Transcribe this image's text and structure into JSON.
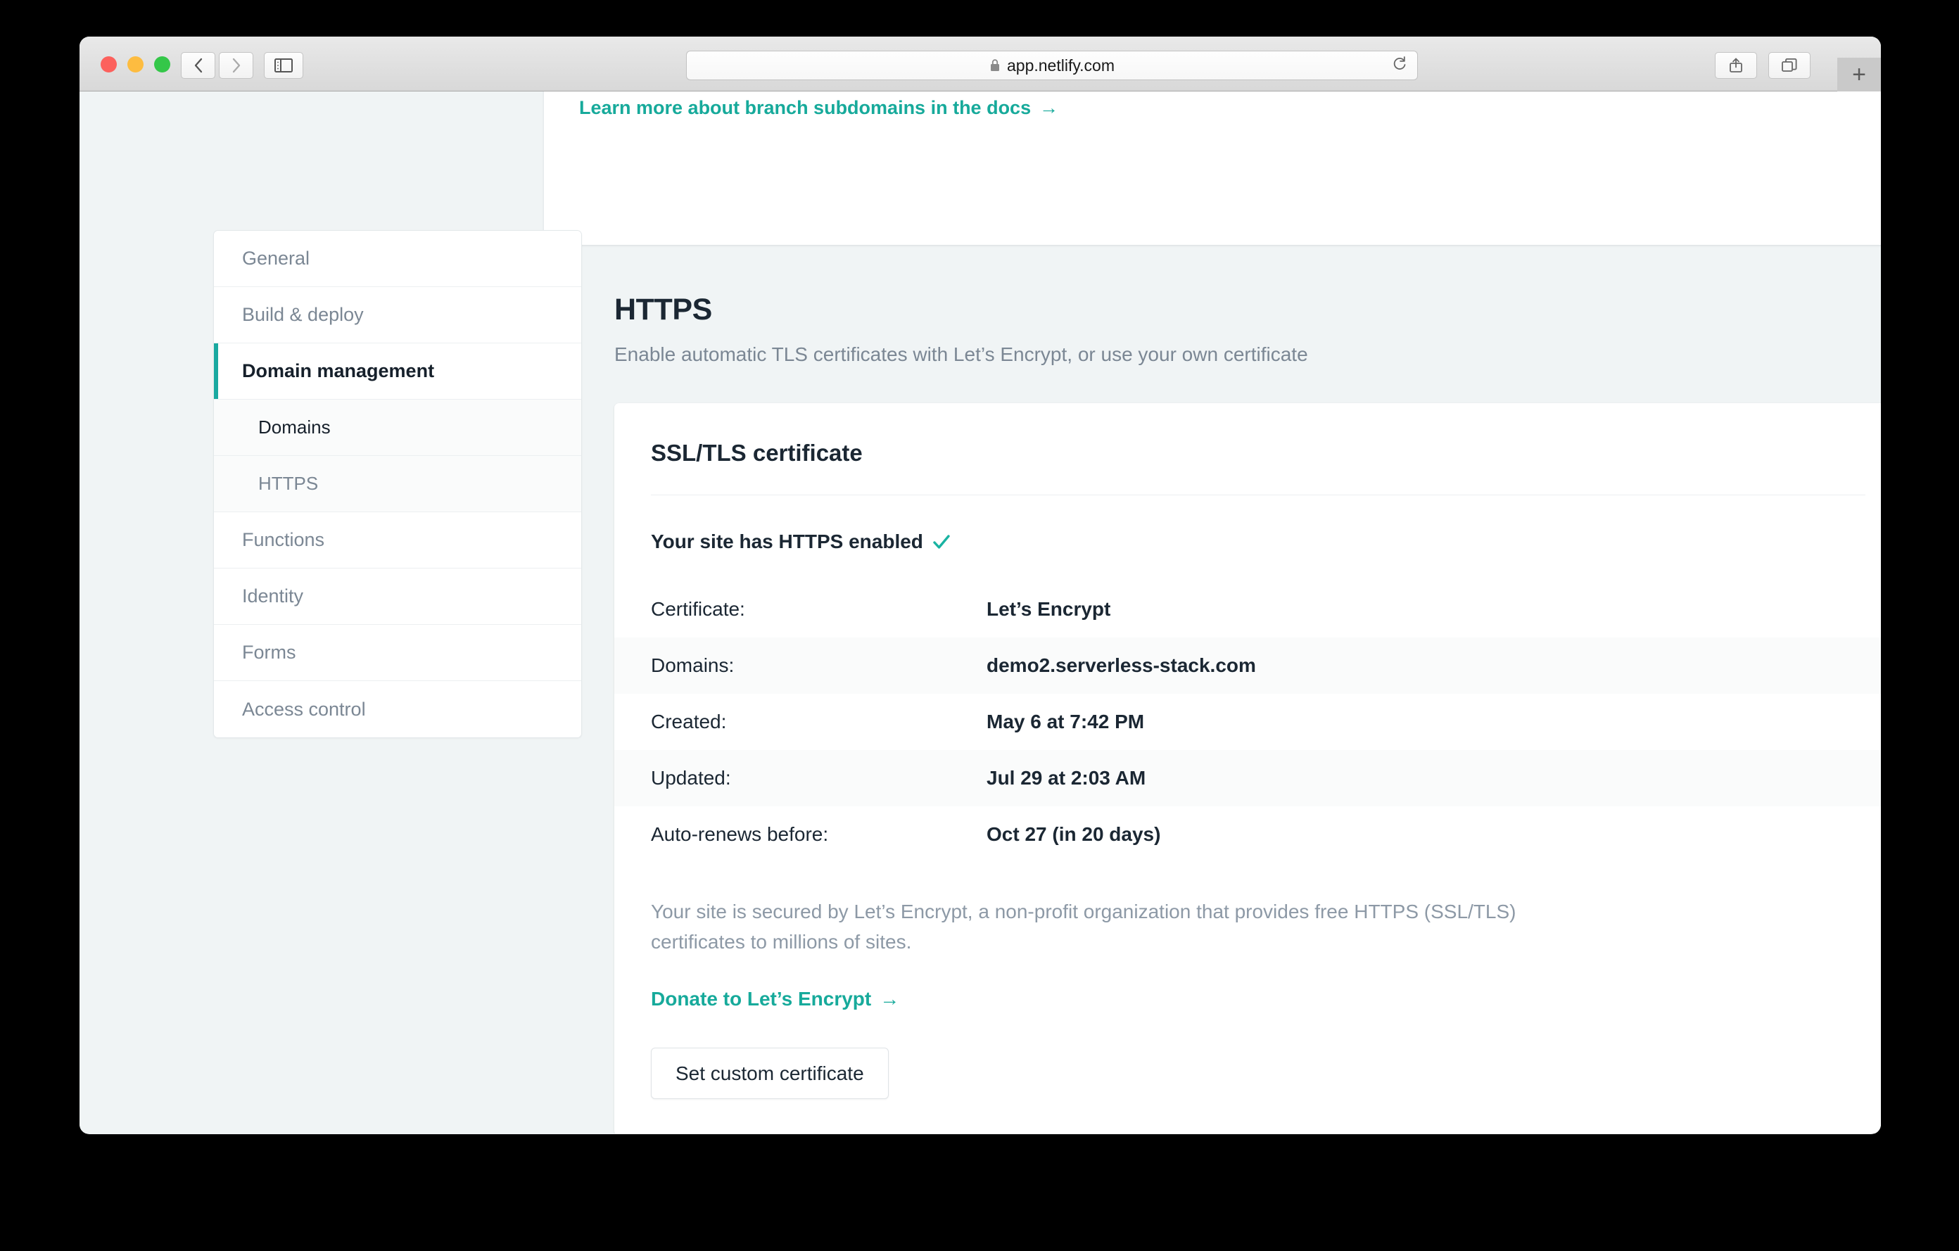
{
  "browser": {
    "url": "app.netlify.com",
    "lock_icon": "lock-icon",
    "back_icon": "chevron-left-icon",
    "forward_icon": "chevron-right-icon",
    "sidebar_icon": "sidebar-toggle-icon",
    "reload_icon": "reload-icon",
    "share_icon": "share-icon",
    "tabs_icon": "tab-overview-icon",
    "new_tab_label": "+"
  },
  "top_card": {
    "docs_link": "Learn more about branch subdomains in the docs",
    "arrow": "→"
  },
  "sidebar": {
    "items": [
      {
        "label": "General",
        "state": "default",
        "level": "top"
      },
      {
        "label": "Build & deploy",
        "state": "default",
        "level": "top"
      },
      {
        "label": "Domain management",
        "state": "active",
        "level": "top"
      },
      {
        "label": "Domains",
        "state": "current",
        "level": "sub"
      },
      {
        "label": "HTTPS",
        "state": "default",
        "level": "sub"
      },
      {
        "label": "Functions",
        "state": "default",
        "level": "top"
      },
      {
        "label": "Identity",
        "state": "default",
        "level": "top"
      },
      {
        "label": "Forms",
        "state": "default",
        "level": "top"
      },
      {
        "label": "Access control",
        "state": "default",
        "level": "top"
      }
    ]
  },
  "main": {
    "title": "HTTPS",
    "subtitle": "Enable automatic TLS certificates with Let’s Encrypt, or use your own certificate"
  },
  "certificate_card": {
    "title": "SSL/TLS certificate",
    "status_text": "Your site has HTTPS enabled",
    "status_check": "✓",
    "rows": [
      {
        "label": "Certificate:",
        "value": "Let’s Encrypt"
      },
      {
        "label": "Domains:",
        "value": "demo2.serverless-stack.com"
      },
      {
        "label": "Created:",
        "value": "May 6 at 7:42 PM"
      },
      {
        "label": "Updated:",
        "value": "Jul 29 at 2:03 AM"
      },
      {
        "label": "Auto-renews before:",
        "value": "Oct 27 (in 20 days)"
      }
    ],
    "note": "Your site is secured by Let’s Encrypt, a non-profit organization that provides free HTTPS (SSL/TLS) certificates to millions of sites.",
    "donate_link": "Donate to Let’s Encrypt",
    "donate_arrow": "→",
    "custom_cert_button": "Set custom certificate"
  },
  "colors": {
    "accent_teal": "#17aa9b",
    "page_background": "#f0f4f5",
    "text_dark": "#1b2733",
    "text_muted": "#7b8794"
  }
}
